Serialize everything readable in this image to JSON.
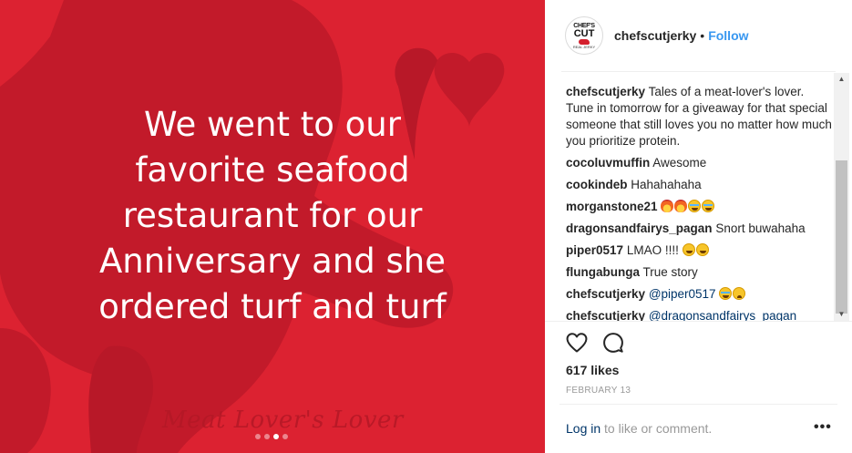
{
  "post_image": {
    "headline_lines": [
      "We went to our",
      "favorite seafood",
      "restaurant for our",
      "Anniversary and she",
      "ordered turf and turf"
    ],
    "script_caption": "Meat Lover's Lover",
    "carousel": {
      "count": 4,
      "active_index": 2
    },
    "colors": {
      "background": "#dc2231",
      "silhouette": "#c21a2a",
      "text": "#ffffff"
    }
  },
  "header": {
    "avatar_text_top": "CHEF'S",
    "avatar_text_main": "CUT",
    "avatar_text_bottom": "REAL JERKY",
    "username": "chefscutjerky",
    "separator": "•",
    "follow_label": "Follow"
  },
  "comments": [
    {
      "user": "chefscutjerky",
      "text": "Tales of a meat-lover's lover. Tune in tomorrow for a giveaway for that special someone that still loves you no matter how much you prioritize protein."
    },
    {
      "user": "cocoluvmuffin",
      "text": "Awesome"
    },
    {
      "user": "cookindeb",
      "text": "Hahahahaha"
    },
    {
      "user": "morganstone21",
      "text": "",
      "emojis": [
        "fire-emoji",
        "fire-emoji",
        "tears-of-joy-emoji",
        "tears-of-joy-emoji"
      ]
    },
    {
      "user": "dragonsandfairys_pagan",
      "text": "Snort buwahaha"
    },
    {
      "user": "piper0517",
      "text": "LMAO !!!!",
      "emojis": [
        "rofl-emoji",
        "rofl-emoji"
      ]
    },
    {
      "user": "flungabunga",
      "text": "True story"
    },
    {
      "user": "chefscutjerky",
      "mention": "@piper0517",
      "emojis": [
        "tears-of-joy-emoji",
        "weary-emoji"
      ]
    },
    {
      "user": "chefscutjerky",
      "mention": "@dragonsandfairys_pagan"
    }
  ],
  "actions": {
    "like_icon": "heart-icon",
    "comment_icon": "comment-icon"
  },
  "likes": "617 likes",
  "date": "FEBRUARY 13",
  "login": {
    "link": "Log in",
    "rest": " to like or comment."
  },
  "more_icon": "•••",
  "scrollbar": {
    "up": "▲",
    "down": "▼"
  }
}
